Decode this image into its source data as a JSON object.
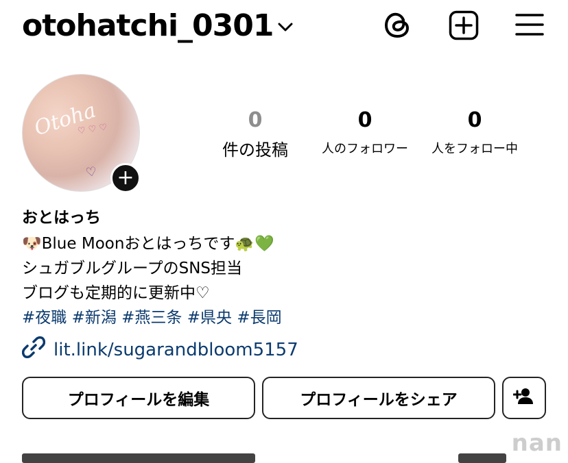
{
  "header": {
    "username": "otohatchi_0301",
    "chevron_icon": "chevron-down-icon",
    "threads_icon": "threads-icon",
    "create_icon": "plus-square-icon",
    "menu_icon": "hamburger-menu-icon"
  },
  "profile": {
    "avatar_watermark": "Otoha",
    "add_story_icon": "plus-icon",
    "display_name": "おとはっち"
  },
  "stats": [
    {
      "value": "0",
      "label": "件の投稿"
    },
    {
      "value": "0",
      "label": "人のフォロワー"
    },
    {
      "value": "0",
      "label": "人をフォロー中"
    }
  ],
  "bio": {
    "line1_emoji_start": "🐶",
    "line1_text": "Blue Moonおとはっちです",
    "line1_emoji_end": "🐢💚",
    "line2": "シュガブルグループのSNS担当",
    "line3": "ブログも定期的に更新中♡",
    "hashtags": "#夜職 #新潟 #燕三条 #県央 #長岡"
  },
  "link": {
    "icon": "link-icon",
    "url": "lit.link/sugarandbloom5157"
  },
  "buttons": {
    "edit_profile": "プロフィールを編集",
    "share_profile": "プロフィールをシェア",
    "add_person_icon": "add-person-icon"
  },
  "watermark": "nan",
  "colors": {
    "link": "#0b3a6e",
    "stat_muted": "#8e8e8e",
    "text": "#000000"
  }
}
